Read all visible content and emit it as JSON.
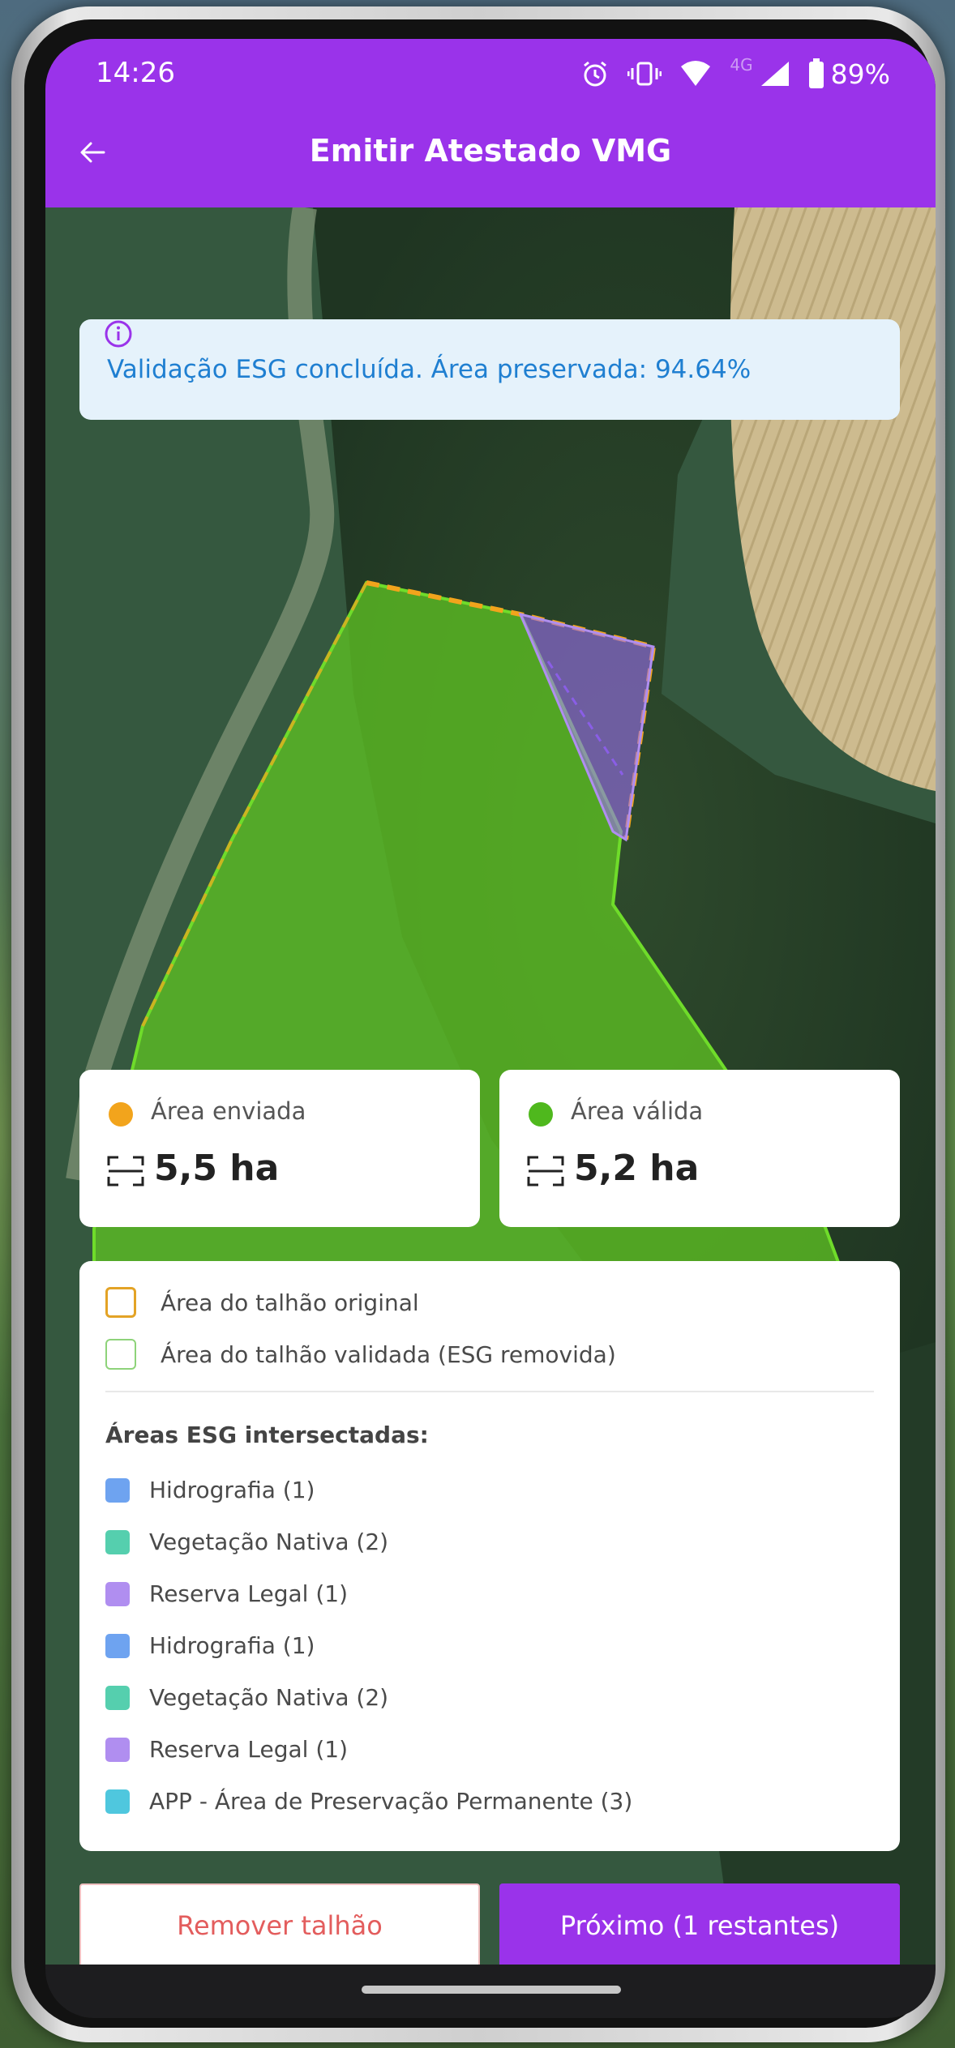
{
  "status_bar": {
    "time": "14:26",
    "network": "4G",
    "battery": "89%",
    "icons": [
      "alarm-icon",
      "vibrate-icon",
      "wifi-icon",
      "cell-signal-icon",
      "battery-icon"
    ]
  },
  "header": {
    "title": "Emitir Atestado VMG",
    "back_icon": "arrow-left-icon",
    "color": "#9a33ea"
  },
  "banner": {
    "message": "Validação ESG concluída. Área preservada: 94.64%",
    "icon": "info-icon"
  },
  "cards": [
    {
      "label": "Área enviada",
      "value": "5,5 ha",
      "dot_color": "#f2a41c"
    },
    {
      "label": "Área válida",
      "value": "5,2 ha",
      "dot_color": "#4fb81d"
    }
  ],
  "legend": {
    "original_label": "Área do talhão original",
    "validated_label": "Área do talhão validada (ESG removida)",
    "intersected_title": "Áreas ESG intersectadas:",
    "items": [
      {
        "label": "Hidrografia (1)",
        "color": "#6ea3f0"
      },
      {
        "label": "Vegetação Nativa (2)",
        "color": "#55cfae"
      },
      {
        "label": "Reserva Legal (1)",
        "color": "#b08ef0"
      },
      {
        "label": "Hidrografia (1)",
        "color": "#6ea3f0"
      },
      {
        "label": "Vegetação Nativa (2)",
        "color": "#55cfae"
      },
      {
        "label": "Reserva Legal (1)",
        "color": "#b08ef0"
      },
      {
        "label": "APP - Área de Preservação Permanente (3)",
        "color": "#4fc7de"
      }
    ]
  },
  "buttons": {
    "remove": "Remover talhão",
    "next": "Próximo (1 restantes)"
  }
}
